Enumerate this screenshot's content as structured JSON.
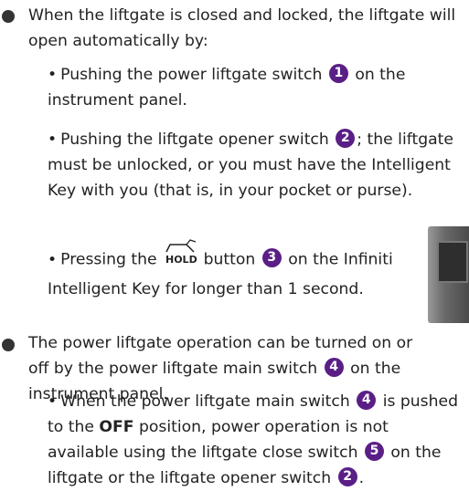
{
  "bullets": [
    {
      "text": "When the liftgate is closed and locked, the liftgate will open automatically by:",
      "items": [
        {
          "pre": "Pushing the power liftgate switch",
          "badge": "1",
          "post": "on the instrument panel."
        },
        {
          "pre": "Pushing the liftgate opener switch",
          "badge": "2",
          "post": "; the liftgate must be unlocked, or you must have the Intelligent Key with you (that is, in your pocket or purse)."
        },
        {
          "pre": "Pressing the",
          "icon_label": "HOLD",
          "mid": "button",
          "badge": "3",
          "post": "on the Infiniti Intelligent Key for longer than 1 second."
        }
      ]
    },
    {
      "text_pre": "The power liftgate operation can be turned on or off by the power liftgate main switch",
      "badge": "4",
      "text_post": "on the instrument panel.",
      "items": [
        {
          "pre": "When the power liftgate main switch",
          "badge_a": "4",
          "mid_a": "is pushed to the",
          "bold": "OFF",
          "mid_b": "position, power operation is not available using the liftgate close switch",
          "badge_b": "5",
          "mid_c": "on the liftgate or the liftgate opener switch",
          "badge_c": "2",
          "post": "."
        }
      ]
    }
  ],
  "sub_bullet_char": "•",
  "colors": {
    "badge": "#5a1f86",
    "text": "#222222"
  }
}
